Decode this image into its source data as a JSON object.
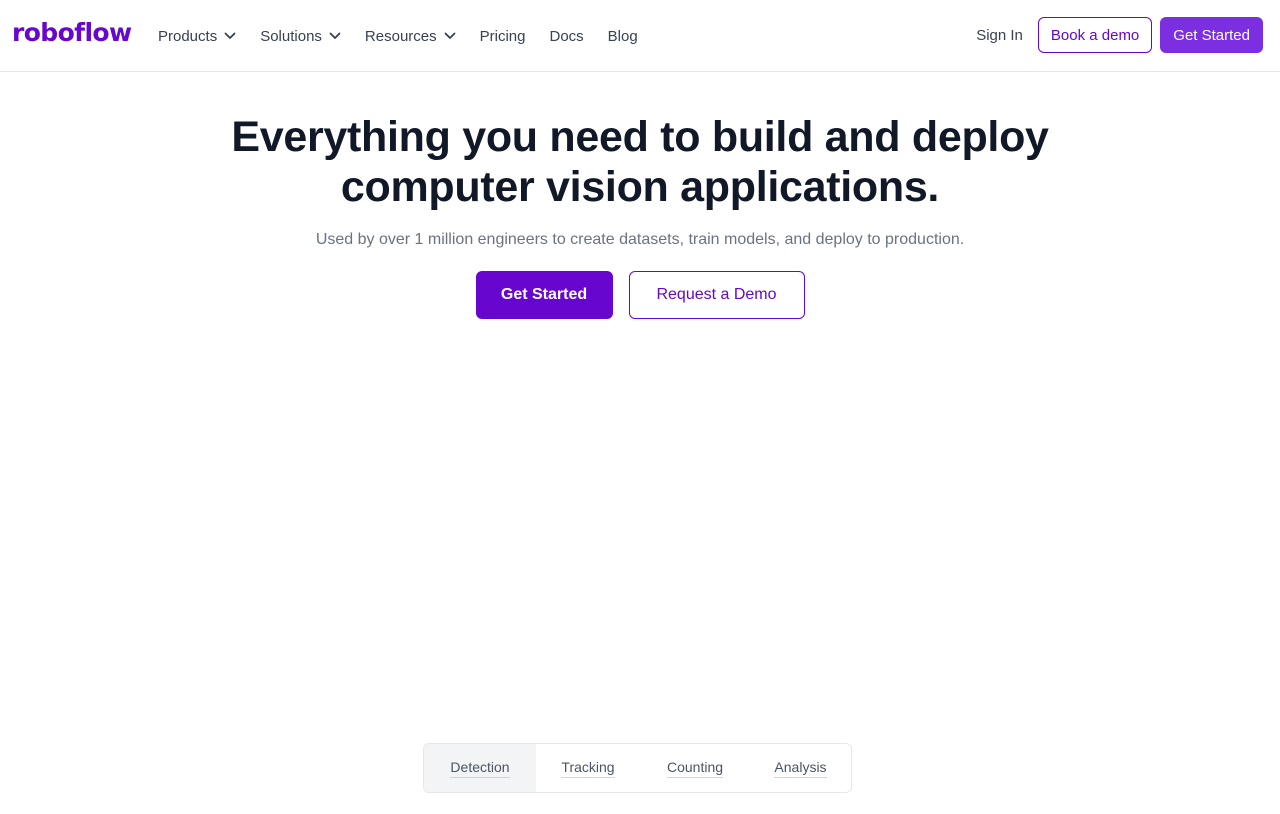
{
  "brand": {
    "logo_text": "roboflow",
    "accent": "#6706ce",
    "accent_light": "#7b2fe0"
  },
  "nav": {
    "items": [
      {
        "label": "Products",
        "has_dropdown": true
      },
      {
        "label": "Solutions",
        "has_dropdown": true
      },
      {
        "label": "Resources",
        "has_dropdown": true
      },
      {
        "label": "Pricing",
        "has_dropdown": false
      },
      {
        "label": "Docs",
        "has_dropdown": false
      },
      {
        "label": "Blog",
        "has_dropdown": false
      }
    ],
    "dropdown_icon": "chevron-down-icon",
    "sign_in": "Sign In",
    "book_demo": "Book a demo",
    "get_started": "Get Started"
  },
  "hero": {
    "title_line1": "Everything you need to build and deploy",
    "title_line2": "computer vision applications.",
    "subtitle": "Used by over 1 million engineers to create datasets, train models, and deploy to production.",
    "primary_button": "Get Started",
    "secondary_button": "Request a Demo"
  },
  "tabs": {
    "items": [
      "Detection",
      "Tracking",
      "Counting",
      "Analysis"
    ],
    "active": "Detection"
  }
}
